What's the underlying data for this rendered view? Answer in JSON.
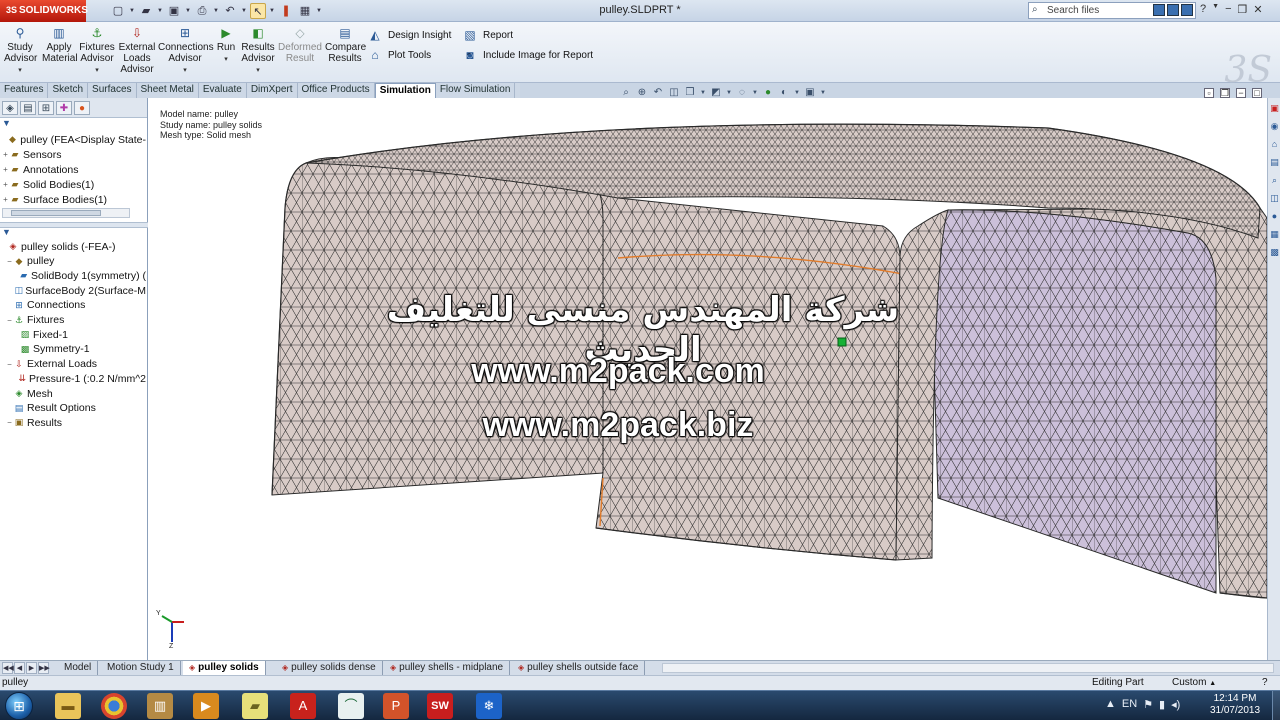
{
  "app": {
    "logo_text": "SOLIDWORKS",
    "document_title": "pulley.SLDPRT *",
    "search_placeholder": "Search files"
  },
  "ribbon": {
    "buttons": [
      {
        "label1": "Study",
        "label2": "Advisor",
        "enabled": true
      },
      {
        "label1": "Apply",
        "label2": "Material",
        "enabled": true
      },
      {
        "label1": "Fixtures",
        "label2": "Advisor",
        "enabled": true
      },
      {
        "label1": "External",
        "label2": "Loads",
        "label3": "Advisor",
        "enabled": true
      },
      {
        "label1": "Connections",
        "label2": "Advisor",
        "enabled": true
      },
      {
        "label1": "Run",
        "enabled": true
      },
      {
        "label1": "Results",
        "label2": "Advisor",
        "enabled": true
      },
      {
        "label1": "Deformed",
        "label2": "Result",
        "enabled": false
      },
      {
        "label1": "Compare",
        "label2": "Results",
        "enabled": true
      }
    ],
    "small_buttons": {
      "design_insight": "Design Insight",
      "plot_tools": "Plot Tools",
      "report": "Report",
      "include_image": "Include Image for Report"
    }
  },
  "command_tabs": [
    "Features",
    "Sketch",
    "Surfaces",
    "Sheet Metal",
    "Evaluate",
    "DimXpert",
    "Office Products",
    "Simulation",
    "Flow Simulation"
  ],
  "active_command_tab": "Simulation",
  "feature_tree": {
    "root": "pulley  (FEA<Display State-",
    "items": [
      "Sensors",
      "Annotations",
      "Solid Bodies(1)",
      "Surface Bodies(1)"
    ]
  },
  "study_tree": {
    "root": "pulley solids (-FEA-)",
    "items": [
      {
        "label": "pulley",
        "indent": 1,
        "icon": "part-icon"
      },
      {
        "label": "SolidBody 1(symmetry) (",
        "indent": 2,
        "icon": "solid-body-icon"
      },
      {
        "label": "SurfaceBody 2(Surface-M",
        "indent": 2,
        "icon": "surface-body-icon"
      },
      {
        "label": "Connections",
        "indent": 1,
        "icon": "connections-icon"
      },
      {
        "label": "Fixtures",
        "indent": 1,
        "icon": "fixtures-icon"
      },
      {
        "label": "Fixed-1",
        "indent": 2,
        "icon": "fixed-icon"
      },
      {
        "label": "Symmetry-1",
        "indent": 2,
        "icon": "symmetry-icon"
      },
      {
        "label": "External Loads",
        "indent": 1,
        "icon": "external-loads-icon"
      },
      {
        "label": "Pressure-1 (:0.2 N/mm^2",
        "indent": 2,
        "icon": "pressure-icon"
      },
      {
        "label": "Mesh",
        "indent": 1,
        "icon": "mesh-icon"
      },
      {
        "label": "Result Options",
        "indent": 1,
        "icon": "result-options-icon"
      },
      {
        "label": "Results",
        "indent": 1,
        "icon": "results-icon"
      }
    ]
  },
  "viewport": {
    "model_info": [
      "Model name: pulley",
      "Study name: pulley solids",
      "Mesh type: Solid mesh"
    ],
    "watermark_arabic": "شركة المهندس منسى للتغليف الحديث",
    "watermark_url1": "www.m2pack.com",
    "watermark_url2": "www.m2pack.biz",
    "triad_y": "Y",
    "triad_z": "Z"
  },
  "bottom_tabs": [
    "Model",
    "Motion Study 1",
    "pulley solids",
    "pulley solids dense",
    "pulley shells - midplane",
    "pulley shells outside face"
  ],
  "active_bottom_tab": "pulley solids",
  "status": {
    "left": "pulley",
    "editing": "Editing Part",
    "units": "Custom"
  },
  "taskbar": {
    "time": "12:14 PM",
    "date": "31/07/2013"
  },
  "colors": {
    "mesh_fill": "#d8cbc7",
    "mesh_inner": "#ccc0da",
    "mesh_line": "#2a2a2a",
    "edge_highlight": "#e07b2b",
    "active_tab": "#ffffff"
  }
}
